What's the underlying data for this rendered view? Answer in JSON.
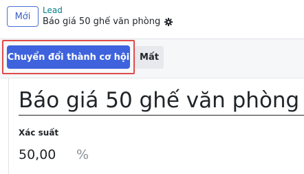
{
  "control_panel": {
    "new_label": "Mới",
    "breadcrumb_parent": "Lead",
    "breadcrumb_current": "Báo giá 50 ghế văn phòng"
  },
  "statusbar": {
    "convert_label": "Chuyển đổi thành cơ hội",
    "lost_label": "Mất"
  },
  "form": {
    "name": "Báo giá 50 ghế văn phòng",
    "probability_label": "Xác suất",
    "probability_value": "50,00",
    "probability_unit": "%"
  },
  "colors": {
    "primary": "#3e63dd",
    "breadcrumb_link": "#017e84",
    "highlight": "#e04a4a"
  },
  "icons": {
    "settings": "gear-icon"
  }
}
